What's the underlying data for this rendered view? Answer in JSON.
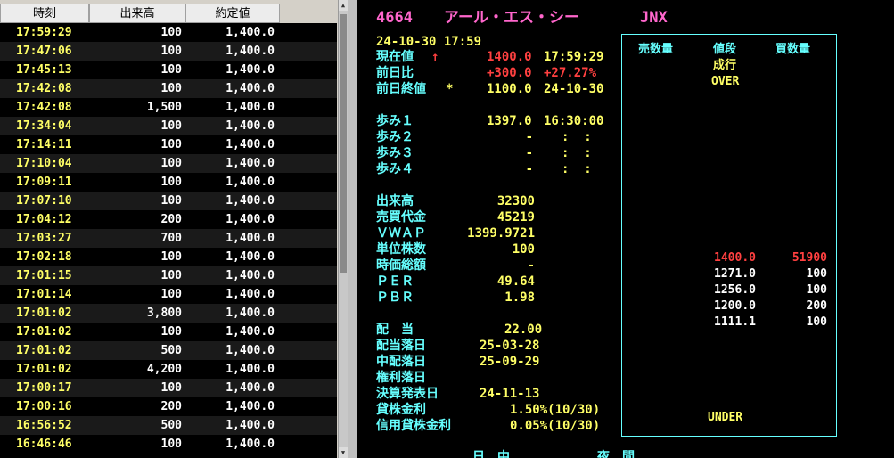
{
  "ticks": {
    "headers": {
      "time": "時刻",
      "volume": "出来高",
      "price": "約定値"
    },
    "rows": [
      {
        "time": "17:59:29",
        "volume": "100",
        "price": "1,400.0"
      },
      {
        "time": "17:47:06",
        "volume": "100",
        "price": "1,400.0"
      },
      {
        "time": "17:45:13",
        "volume": "100",
        "price": "1,400.0"
      },
      {
        "time": "17:42:08",
        "volume": "100",
        "price": "1,400.0"
      },
      {
        "time": "17:42:08",
        "volume": "1,500",
        "price": "1,400.0"
      },
      {
        "time": "17:34:04",
        "volume": "100",
        "price": "1,400.0"
      },
      {
        "time": "17:14:11",
        "volume": "100",
        "price": "1,400.0"
      },
      {
        "time": "17:10:04",
        "volume": "100",
        "price": "1,400.0"
      },
      {
        "time": "17:09:11",
        "volume": "100",
        "price": "1,400.0"
      },
      {
        "time": "17:07:10",
        "volume": "100",
        "price": "1,400.0"
      },
      {
        "time": "17:04:12",
        "volume": "200",
        "price": "1,400.0"
      },
      {
        "time": "17:03:27",
        "volume": "700",
        "price": "1,400.0"
      },
      {
        "time": "17:02:18",
        "volume": "100",
        "price": "1,400.0"
      },
      {
        "time": "17:01:15",
        "volume": "100",
        "price": "1,400.0"
      },
      {
        "time": "17:01:14",
        "volume": "100",
        "price": "1,400.0"
      },
      {
        "time": "17:01:02",
        "volume": "3,800",
        "price": "1,400.0"
      },
      {
        "time": "17:01:02",
        "volume": "100",
        "price": "1,400.0"
      },
      {
        "time": "17:01:02",
        "volume": "500",
        "price": "1,400.0"
      },
      {
        "time": "17:01:02",
        "volume": "4,200",
        "price": "1,400.0"
      },
      {
        "time": "17:00:17",
        "volume": "100",
        "price": "1,400.0"
      },
      {
        "time": "17:00:16",
        "volume": "200",
        "price": "1,400.0"
      },
      {
        "time": "16:56:52",
        "volume": "500",
        "price": "1,400.0"
      },
      {
        "time": "16:46:46",
        "volume": "100",
        "price": "1,400.0"
      }
    ]
  },
  "quote": {
    "code": "4664",
    "name": "アール・エス・シー",
    "market": "JNX",
    "datetime": "24-10-30 17:59",
    "current_label": "現在値",
    "current_arrow": "↑",
    "current_value": "1400.0",
    "current_time": "17:59:29",
    "change_label": "前日比",
    "change_value": "+300.0",
    "change_pct": "+27.27%",
    "prev_close_label": "前日終値",
    "prev_close_mark": "*",
    "prev_close_value": "1100.0",
    "prev_close_date": "24-10-30",
    "ayumi": [
      {
        "label": "歩み１",
        "price": "1397.0",
        "time": "16:30:00"
      },
      {
        "label": "歩み２",
        "price": "-",
        "time": ":  :"
      },
      {
        "label": "歩み３",
        "price": "-",
        "time": ":  :"
      },
      {
        "label": "歩み４",
        "price": "-",
        "time": ":  :"
      }
    ],
    "stats": [
      {
        "label": "出来高",
        "value": "32300"
      },
      {
        "label": "売買代金",
        "value": "45219"
      },
      {
        "label": "ＶＷＡＰ",
        "value": "1399.9721"
      },
      {
        "label": "単位株数",
        "value": "100"
      },
      {
        "label": "時価総額",
        "value": "-"
      },
      {
        "label": "ＰＥＲ",
        "value": "49.64"
      },
      {
        "label": "ＰＢＲ",
        "value": "1.98"
      }
    ],
    "dividend_label": "配　当",
    "dividend_value": "22.00",
    "ex_div_label": "配当落日",
    "ex_div_value": "25-03-28",
    "interim_label": "中配落日",
    "interim_value": "25-09-29",
    "rights_label": "権利落日",
    "rights_value": "",
    "earnings_label": "決算発表日",
    "earnings_value": "24-11-13",
    "lend_rate_label": "貸株金利",
    "lend_rate_value": "1.50%(10/30)",
    "margin_rate_label": "信用貸株金利",
    "margin_rate_value": "0.05%(10/30)",
    "bottom_day": "日　中",
    "bottom_night": "夜　間"
  },
  "board": {
    "sell_header": "売数量",
    "price_header": "値段",
    "buy_header": "買数量",
    "market_order": "成行",
    "over": "OVER",
    "under": "UNDER",
    "rows": [
      {
        "price": "1400.0",
        "buy": "51900",
        "highlight": true
      },
      {
        "price": "1271.0",
        "buy": "100",
        "highlight": false
      },
      {
        "price": "1256.0",
        "buy": "100",
        "highlight": false
      },
      {
        "price": "1200.0",
        "buy": "200",
        "highlight": false
      },
      {
        "price": "1111.1",
        "buy": "100",
        "highlight": false
      }
    ]
  }
}
